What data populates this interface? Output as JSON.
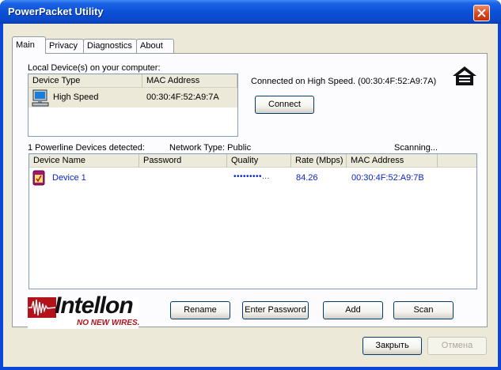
{
  "window": {
    "title": "PowerPacket Utility"
  },
  "tabs": [
    {
      "label": "Main",
      "active": true
    },
    {
      "label": "Privacy"
    },
    {
      "label": "Diagnostics"
    },
    {
      "label": "About"
    }
  ],
  "local": {
    "group_label": "Local Device(s) on your computer:",
    "columns": [
      "Device Type",
      "MAC Address"
    ],
    "rows": [
      {
        "type": "High Speed",
        "mac": "00:30:4F:52:A9:7A",
        "icon": "computer-icon"
      }
    ],
    "connected_text": "Connected on  High Speed. (00:30:4F:52:A9:7A)",
    "connect_label": "Connect"
  },
  "status": {
    "detected": "1 Powerline Devices detected:",
    "network_type": "Network Type: Public",
    "scanning": "Scanning..."
  },
  "remote": {
    "columns": [
      "Device Name",
      "Password",
      "Quality",
      "Rate (Mbps)",
      "MAC Address"
    ],
    "rows": [
      {
        "name": "Device 1",
        "password": "",
        "quality": "•••••••••...",
        "rate": "84.26",
        "mac": "00:30:4F:52:A9:7B",
        "icon": "powerline-device-icon"
      }
    ]
  },
  "buttons": {
    "rename": "Rename",
    "enter_password": "Enter Password",
    "add": "Add",
    "scan": "Scan"
  },
  "logo": {
    "brand": "Intellon",
    "tagline": "NO NEW WIRES."
  },
  "footer": {
    "close": "Закрыть",
    "cancel": "Отмена"
  },
  "colors": {
    "title_bar": "#0a52d9",
    "link_text": "#0b24c4",
    "logo_red": "#b3121a"
  }
}
